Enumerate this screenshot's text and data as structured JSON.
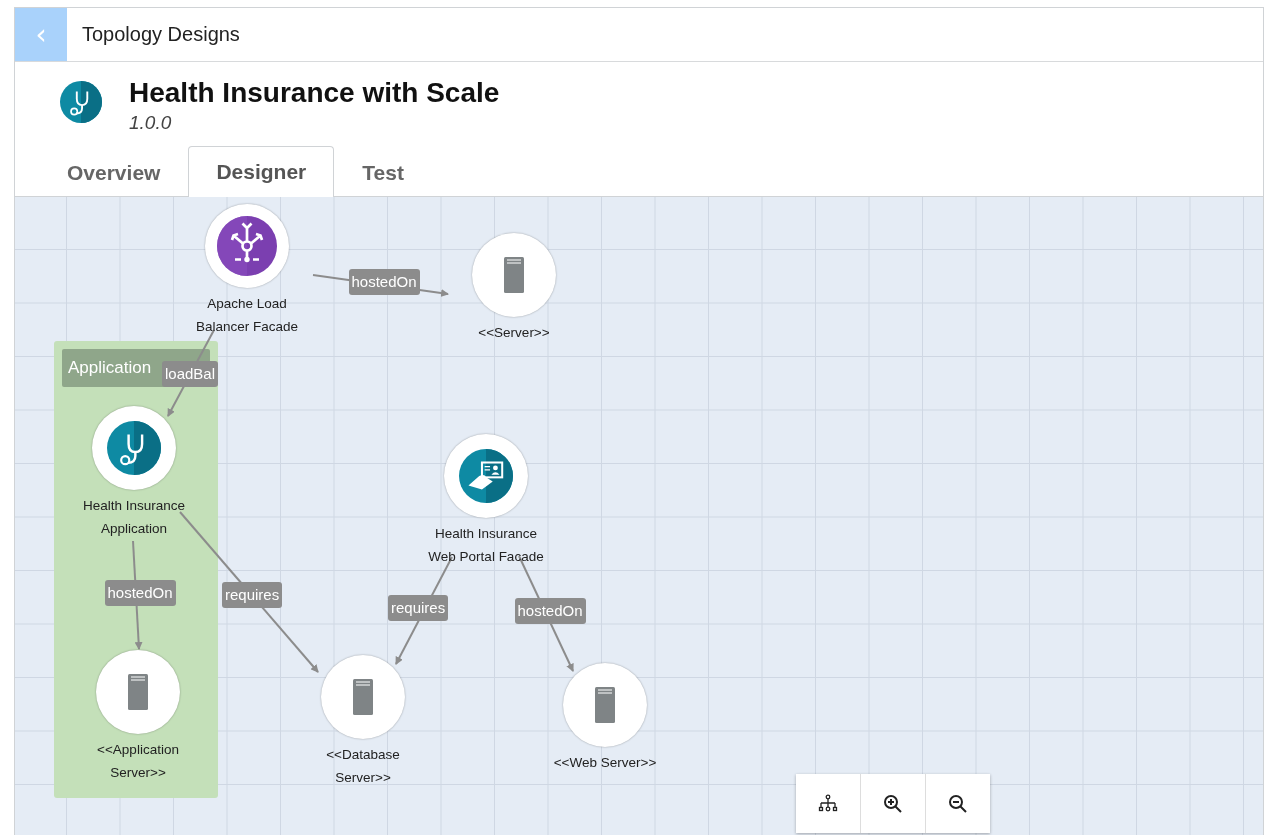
{
  "breadcrumb": {
    "back": "‹",
    "title": "Topology Designs"
  },
  "design": {
    "name": "Health Insurance with Scale",
    "version": "1.0.0"
  },
  "tabs": [
    {
      "label": "Overview",
      "selected": false
    },
    {
      "label": "Designer",
      "selected": true
    },
    {
      "label": "Test",
      "selected": false
    }
  ],
  "canvas": {
    "groups": [
      {
        "label": "Application"
      }
    ],
    "nodes": [
      {
        "kind": "load_balancer",
        "label": "Apache Load Balancer Facade"
      },
      {
        "kind": "server",
        "label": "<<Server>>"
      },
      {
        "kind": "application",
        "label": "Health Insurance Application"
      },
      {
        "kind": "portal",
        "label": "Health Insurance Web Portal Facade"
      },
      {
        "kind": "server",
        "label": "<<Application Server>>"
      },
      {
        "kind": "server",
        "label": "<<Database Server>>"
      },
      {
        "kind": "server",
        "label": "<<Web Server>>"
      }
    ],
    "edges": [
      {
        "label": "hostedOn"
      },
      {
        "label": "loadBal"
      },
      {
        "label": "hostedOn"
      },
      {
        "label": "requires"
      },
      {
        "label": "requires"
      },
      {
        "label": "hostedOn"
      }
    ]
  },
  "toolbar": [
    {
      "kind": "layout"
    },
    {
      "kind": "zoom_in"
    },
    {
      "kind": "zoom_out"
    }
  ]
}
